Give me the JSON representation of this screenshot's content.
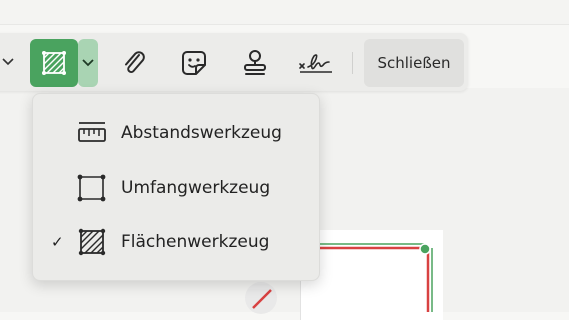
{
  "toolbar": {
    "tools": [
      {
        "name": "area-measure-icon",
        "active": true
      },
      {
        "name": "paperclip-icon"
      },
      {
        "name": "sticker-icon"
      },
      {
        "name": "stamp-icon"
      },
      {
        "name": "signature-icon"
      }
    ],
    "close_label": "Schließen",
    "accent": "#4aa35f"
  },
  "menu": {
    "items": [
      {
        "label": "Abstandswerkzeug",
        "icon": "ruler-icon",
        "checked": false
      },
      {
        "label": "Umfangwerkzeug",
        "icon": "perimeter-icon",
        "checked": false
      },
      {
        "label": "Flächenwerkzeug",
        "icon": "area-icon",
        "checked": true
      }
    ],
    "check_glyph": "✓"
  },
  "drawing": {
    "line_colors": [
      "#d84242",
      "#4aa35f"
    ]
  }
}
